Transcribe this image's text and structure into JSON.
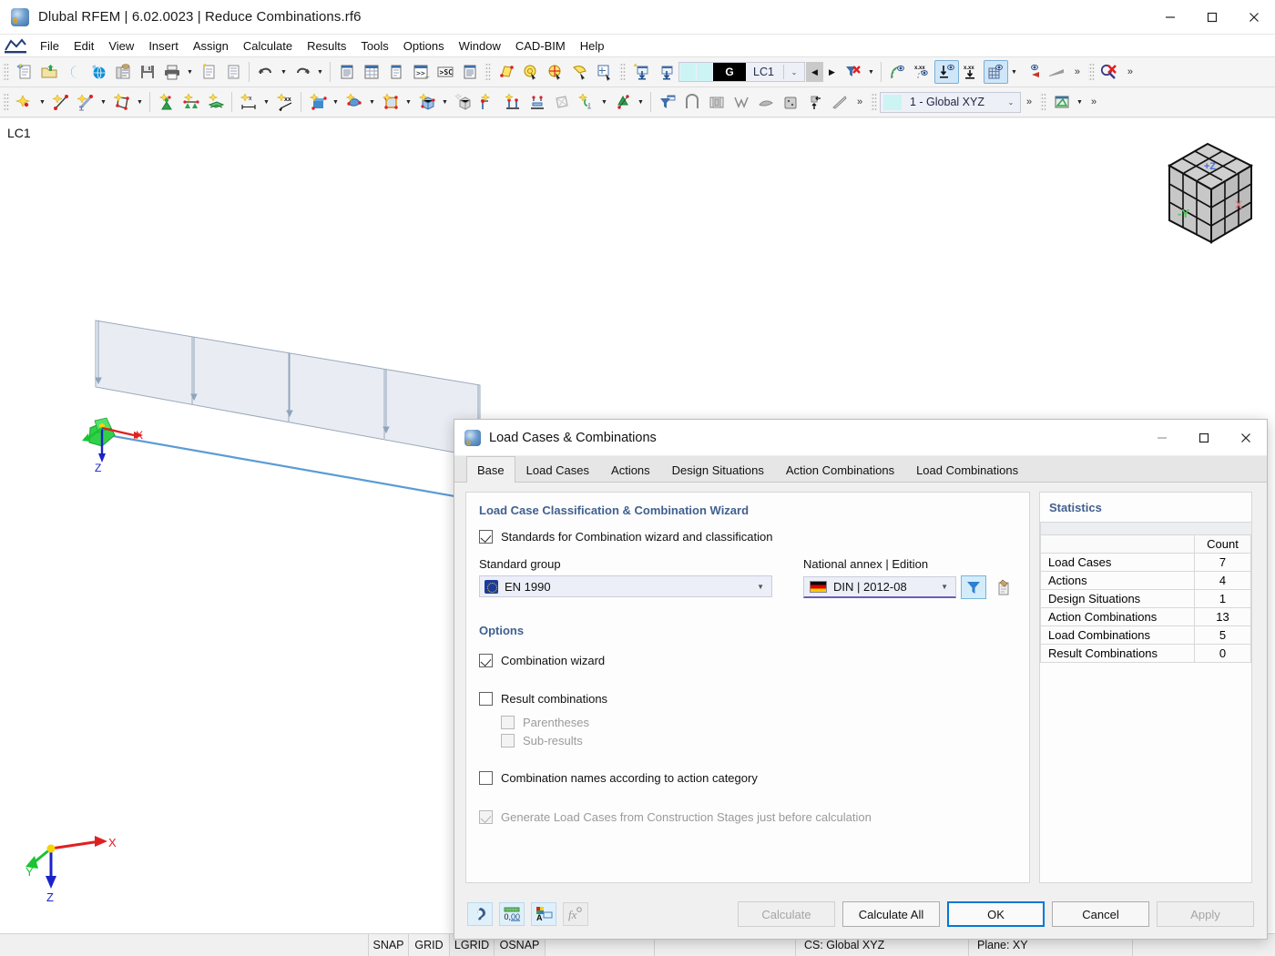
{
  "window": {
    "title": "Dlubal RFEM | 6.02.0023 | Reduce Combinations.rf6",
    "app_icon": "dlubal-logo-icon",
    "minimize": "—",
    "maximize": "☐",
    "close": "✕"
  },
  "menubar": {
    "items": [
      {
        "label": "File"
      },
      {
        "label": "Edit"
      },
      {
        "label": "View"
      },
      {
        "label": "Insert"
      },
      {
        "label": "Assign"
      },
      {
        "label": "Calculate"
      },
      {
        "label": "Results"
      },
      {
        "label": "Tools"
      },
      {
        "label": "Options"
      },
      {
        "label": "Window"
      },
      {
        "label": "CAD-BIM"
      },
      {
        "label": "Help"
      }
    ]
  },
  "toolbar_row1": {
    "load_case_combo": {
      "tag": "G",
      "value": "LC1",
      "dropdown_arrow": "⌄",
      "prev_arrow": "◀",
      "next_arrow": "▶"
    },
    "overflow": "»",
    "xxx_labels": [
      "x.xx",
      "x.xx",
      "x.xx"
    ]
  },
  "toolbar_row2": {
    "cs_combo": {
      "value": "1 - Global XYZ",
      "dropdown_arrow": "⌄"
    },
    "overflow": "»"
  },
  "workspace": {
    "load_case_label": "LC1",
    "axis": {
      "x": "X",
      "y": "Y",
      "z": "Z"
    },
    "navcube": {
      "top_face": "+Z",
      "front_face": "-Y",
      "side_face": "X"
    }
  },
  "statusbar": {
    "cells": [
      "SNAP",
      "GRID",
      "LGRID",
      "OSNAP"
    ],
    "cs": "CS: Global XYZ",
    "plane": "Plane: XY"
  },
  "dialog": {
    "title": "Load Cases & Combinations",
    "minimize": "—",
    "maximize": "☐",
    "close": "✕",
    "tabs": [
      {
        "label": "Base",
        "active": true
      },
      {
        "label": "Load Cases",
        "active": false
      },
      {
        "label": "Actions",
        "active": false
      },
      {
        "label": "Design Situations",
        "active": false
      },
      {
        "label": "Action Combinations",
        "active": false
      },
      {
        "label": "Load Combinations",
        "active": false
      }
    ],
    "classification": {
      "group_title": "Load Case Classification & Combination Wizard",
      "standards_checkbox": {
        "label": "Standards for Combination wizard and classification",
        "checked": true
      },
      "standard_group": {
        "label": "Standard group",
        "value": "EN 1990",
        "flag": "eu-flag-icon"
      },
      "national_annex": {
        "label": "National annex | Edition",
        "value": "DIN | 2012-08",
        "flag": "german-flag-icon"
      },
      "filter_button_icon": "filter-funnel-icon",
      "edit_button_icon": "edit-standard-icon"
    },
    "options": {
      "group_title": "Options",
      "items": [
        {
          "label": "Combination wizard",
          "checked": true,
          "enabled": true,
          "indent": 0
        },
        {
          "label": "Result combinations",
          "checked": false,
          "enabled": true,
          "indent": 0
        },
        {
          "label": "Parentheses",
          "checked": false,
          "enabled": false,
          "indent": 1
        },
        {
          "label": "Sub-results",
          "checked": false,
          "enabled": false,
          "indent": 1
        },
        {
          "label": "Combination names according to action category",
          "checked": false,
          "enabled": true,
          "indent": 0
        },
        {
          "label": "Generate Load Cases from Construction Stages just before calculation",
          "checked": true,
          "enabled": false,
          "indent": 0
        }
      ]
    },
    "statistics": {
      "title": "Statistics",
      "column_header": "Count",
      "rows": [
        {
          "name": "Load Cases",
          "count": "7"
        },
        {
          "name": "Actions",
          "count": "4"
        },
        {
          "name": "Design Situations",
          "count": "1"
        },
        {
          "name": "Action Combinations",
          "count": "13"
        },
        {
          "name": "Load Combinations",
          "count": "5"
        },
        {
          "name": "Result Combinations",
          "count": "0"
        }
      ]
    },
    "footer": {
      "icons": [
        {
          "name": "help-icon",
          "enabled": true
        },
        {
          "name": "units-decimal-places-icon",
          "enabled": true
        },
        {
          "name": "display-properties-icon",
          "enabled": true
        },
        {
          "name": "formula-icon",
          "enabled": false
        }
      ],
      "buttons": [
        {
          "label": "Calculate",
          "state": "disabled"
        },
        {
          "label": "Calculate All",
          "state": "normal"
        },
        {
          "label": "OK",
          "state": "default"
        },
        {
          "label": "Cancel",
          "state": "normal"
        },
        {
          "label": "Apply",
          "state": "disabled"
        }
      ]
    }
  },
  "colors": {
    "accent_blue": "#0078d7",
    "group_title": "#41608f",
    "dialog_bg": "#f0f0f0",
    "panel_bg": "#fdfdfd",
    "combo_bg": "#eceff8",
    "underline_purple": "#6a5fb0"
  }
}
